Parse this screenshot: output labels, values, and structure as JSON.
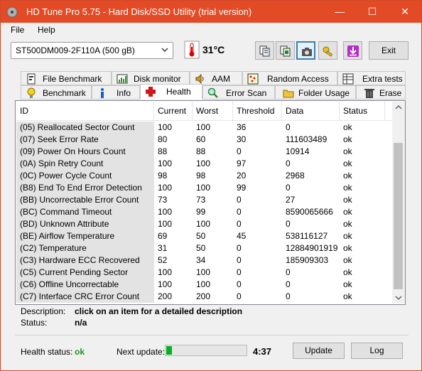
{
  "window": {
    "title": "HD Tune Pro 5.75 - Hard Disk/SSD Utility (trial version)",
    "titlebar_color": "#e24b26",
    "controls": {
      "minimize": "—",
      "maximize": "☐",
      "close": "✕"
    }
  },
  "menu": {
    "file": "File",
    "help": "Help"
  },
  "toolbar": {
    "drive": "ST500DM009-2F110A (500 gB)",
    "temperature": "31°C",
    "exit_label": "Exit",
    "icons": [
      "copy-icon",
      "copy-info-icon",
      "screenshot-camera-icon",
      "options-key-icon",
      "save-down-arrow-icon"
    ]
  },
  "tabs": {
    "row1": [
      "File Benchmark",
      "Disk monitor",
      "AAM",
      "Random Access",
      "Extra tests"
    ],
    "row2": [
      "Benchmark",
      "Info",
      "Health",
      "Error Scan",
      "Folder Usage",
      "Erase"
    ],
    "selected": "Health"
  },
  "table": {
    "columns": [
      "ID",
      "Current",
      "Worst",
      "Threshold",
      "Data",
      "Status"
    ],
    "rows": [
      [
        "(05) Reallocated Sector Count",
        "100",
        "100",
        "36",
        "0",
        "ok"
      ],
      [
        "(07) Seek Error Rate",
        "80",
        "60",
        "30",
        "111603489",
        "ok"
      ],
      [
        "(09) Power On Hours Count",
        "88",
        "88",
        "0",
        "10914",
        "ok"
      ],
      [
        "(0A) Spin Retry Count",
        "100",
        "100",
        "97",
        "0",
        "ok"
      ],
      [
        "(0C) Power Cycle Count",
        "98",
        "98",
        "20",
        "2968",
        "ok"
      ],
      [
        "(B8) End To End Error Detection",
        "100",
        "100",
        "99",
        "0",
        "ok"
      ],
      [
        "(BB) Uncorrectable Error Count",
        "73",
        "73",
        "0",
        "27",
        "ok"
      ],
      [
        "(BC) Command Timeout",
        "100",
        "99",
        "0",
        "8590065666",
        "ok"
      ],
      [
        "(BD) Unknown Attribute",
        "100",
        "100",
        "0",
        "0",
        "ok"
      ],
      [
        "(BE) Airflow Temperature",
        "69",
        "50",
        "45",
        "538116127",
        "ok"
      ],
      [
        "(C2) Temperature",
        "31",
        "50",
        "0",
        "12884901919",
        "ok"
      ],
      [
        "(C3) Hardware ECC Recovered",
        "52",
        "34",
        "0",
        "185909303",
        "ok"
      ],
      [
        "(C5) Current Pending Sector",
        "100",
        "100",
        "0",
        "0",
        "ok"
      ],
      [
        "(C6) Offline Uncorrectable",
        "100",
        "100",
        "0",
        "0",
        "ok"
      ],
      [
        "(C7) Interface CRC Error Count",
        "200",
        "200",
        "0",
        "0",
        "ok"
      ]
    ]
  },
  "details": {
    "description_label": "Description:",
    "description_value": "click on an item for a detailed description",
    "status_label": "Status:",
    "status_value": "n/a"
  },
  "footer": {
    "health_label": "Health status:",
    "health_value": "ok",
    "health_color": "#1a9a1a",
    "next_update_label": "Next update:",
    "progress_fraction": 0.07,
    "timer": "4:37",
    "update_label": "Update",
    "log_label": "Log"
  }
}
